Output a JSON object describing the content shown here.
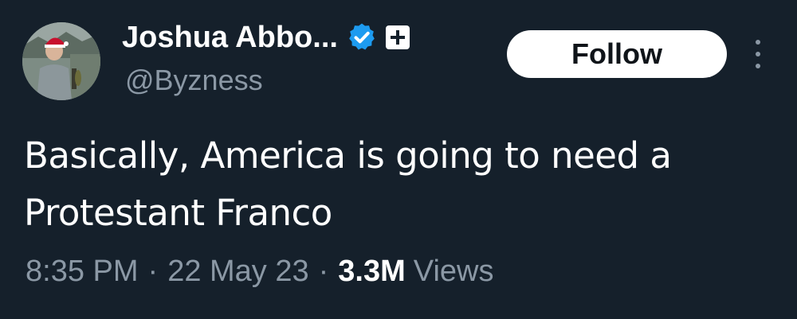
{
  "author": {
    "display_name": "Joshua Abbo...",
    "handle": "@Byzness",
    "avatar_icon": "profile-photo",
    "verified_icon": "verified-checkmark-icon",
    "verified_color": "#1d9bf0",
    "affiliation_icon": "affiliation-badge-icon"
  },
  "actions": {
    "follow_label": "Follow",
    "more_icon": "more-vertical-icon"
  },
  "tweet": {
    "text": "Basically, America is going to need a Protestant Franco"
  },
  "meta": {
    "time": "8:35 PM",
    "separator": "·",
    "date": "22 May 23",
    "views_count": "3.3M",
    "views_label": "Views"
  },
  "colors": {
    "background": "#15202b",
    "text_primary": "#ffffff",
    "text_secondary": "#8b98a5"
  }
}
